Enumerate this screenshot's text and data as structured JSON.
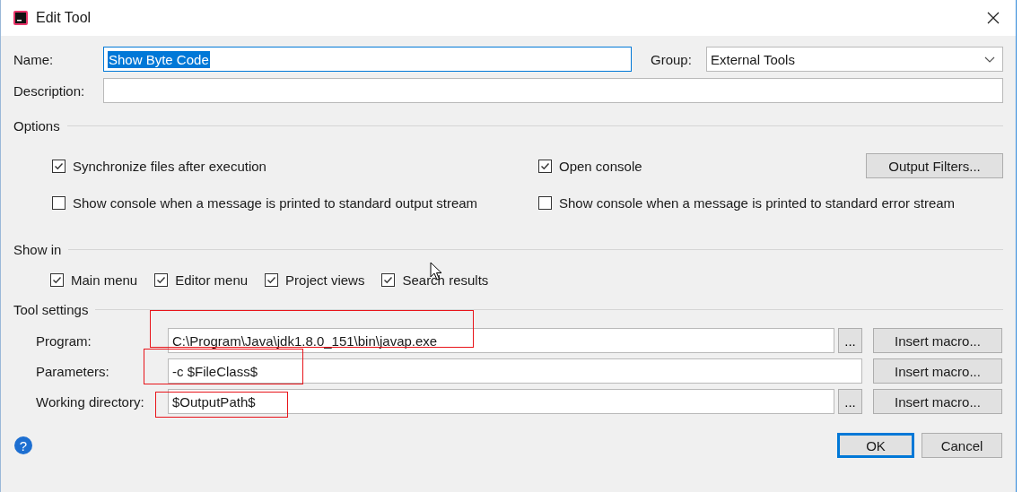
{
  "window": {
    "title": "Edit Tool"
  },
  "name": {
    "label": "Name:",
    "value": "Show Byte Code",
    "text_selected": true
  },
  "group": {
    "label": "Group:",
    "value": "External Tools"
  },
  "description": {
    "label": "Description:"
  },
  "options": {
    "heading": "Options",
    "output_filters": "Output Filters...",
    "items": [
      {
        "label": "Synchronize files after execution",
        "checked": true
      },
      {
        "label": "Open console",
        "checked": true
      },
      {
        "label": "Show console when a message is printed to standard output stream",
        "checked": false
      },
      {
        "label": "Show console when a message is printed to standard error stream",
        "checked": false
      }
    ]
  },
  "show_in": {
    "heading": "Show in",
    "items": [
      {
        "label": "Main menu",
        "checked": true
      },
      {
        "label": "Editor menu",
        "checked": true
      },
      {
        "label": "Project views",
        "checked": true
      },
      {
        "label": "Search results",
        "checked": true
      }
    ]
  },
  "tool_settings": {
    "heading": "Tool settings",
    "fields": [
      {
        "label": "Program:",
        "value": "C:\\Program\\Java\\jdk1.8.0_151\\bin\\javap.exe",
        "browse": "...",
        "macro": "Insert macro...",
        "annotated": true
      },
      {
        "label": "Parameters:",
        "value": "-c $FileClass$",
        "macro": "Insert macro...",
        "annotated": true
      },
      {
        "label": "Working directory:",
        "value": "$OutputPath$",
        "browse": "...",
        "macro": "Insert macro...",
        "annotated": true
      }
    ]
  },
  "help": "?",
  "buttons": [
    {
      "label": "OK",
      "default": true
    },
    {
      "label": "Cancel",
      "default": false
    }
  ]
}
